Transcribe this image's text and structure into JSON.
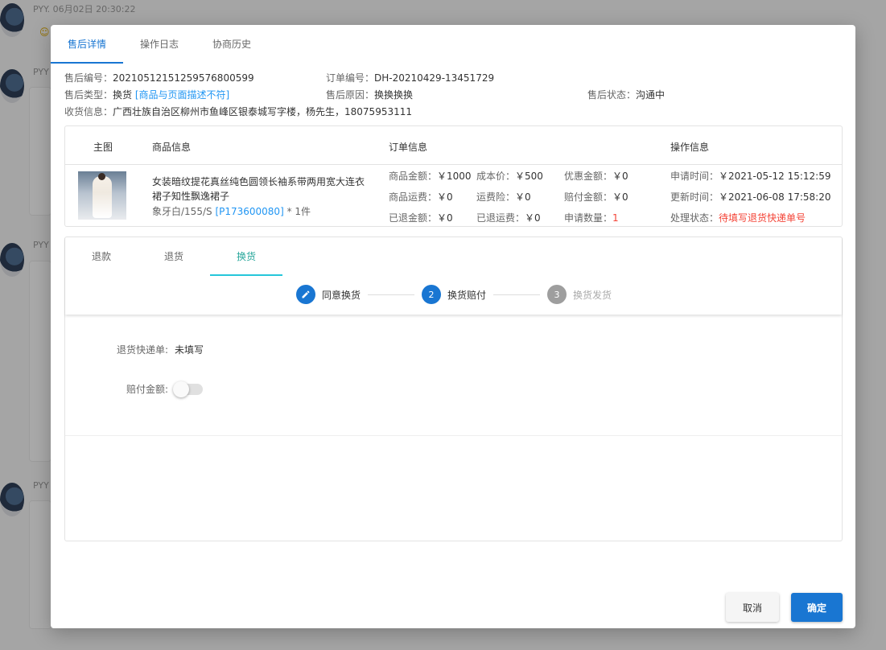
{
  "background": {
    "chat_name": "PYY",
    "chat_time": "06月02日 20:30:22",
    "names": [
      "PYY",
      "PYY",
      "PYY"
    ]
  },
  "tabs": [
    {
      "label": "售后详情",
      "active": true
    },
    {
      "label": "操作日志",
      "active": false
    },
    {
      "label": "协商历史",
      "active": false
    }
  ],
  "info": {
    "aftersale_no_label": "售后编号：",
    "aftersale_no": "20210512151259576800599",
    "order_no_label": "订单编号：",
    "order_no": "DH-20210429-13451729",
    "type_label": "售后类型：",
    "type": "换货",
    "type_reason_link": "[商品与页面描述不符]",
    "reason_label": "售后原因：",
    "reason": "换换换换",
    "status_label": "售后状态：",
    "status": "沟通中",
    "address_label": "收货信息：",
    "address": "广西壮族自治区柳州市鱼峰区银泰城写字楼，杨先生，18075953111"
  },
  "goods_table": {
    "headers": [
      "主图",
      "商品信息",
      "订单信息",
      "操作信息"
    ],
    "goods_name": "女装暗纹提花真丝纯色圆领长袖系带两用宽大连衣裙子知性飘逸裙子",
    "spec_prefix": "象牙白/155/S",
    "sku_link": "[P173600080]",
    "qty": "* 1件",
    "order": {
      "goods_amount_label": "商品金额：",
      "goods_amount": "￥1000",
      "cost_label": "成本价：",
      "cost": "￥500",
      "discount_label": "优惠金额：",
      "discount": "￥0",
      "freight_label": "商品运费：",
      "freight": "￥0",
      "freight_ins_label": "运费险：",
      "freight_ins": "￥0",
      "compensation_label": "赔付金额：",
      "compensation": "￥0",
      "refunded_label": "已退金额：",
      "refunded": "￥0",
      "refunded_freight_label": "已退运费：",
      "refunded_freight": "￥0",
      "apply_qty_label": "申请数量：",
      "apply_qty": "1"
    },
    "operation": {
      "apply_time_label": "申请时间：",
      "apply_time": "￥2021-05-12 15:12:59",
      "update_time_label": "更新时间：",
      "update_time": "￥2021-06-08 17:58:20",
      "process_status_label": "处理状态：",
      "process_status": "待填写退货快递单号"
    }
  },
  "sub_tabs": [
    {
      "label": "退款",
      "active": false
    },
    {
      "label": "退货",
      "active": false
    },
    {
      "label": "换货",
      "active": true
    }
  ],
  "steps": [
    {
      "label": "同意换货",
      "num": "",
      "state": "done"
    },
    {
      "label": "换货赔付",
      "num": "2",
      "state": "active"
    },
    {
      "label": "换货发货",
      "num": "3",
      "state": "pending"
    }
  ],
  "form": {
    "return_express_label": "退货快递单:",
    "return_express_value": "未填写",
    "compensation_label": "赔付金额:",
    "compensation_toggle_on": false
  },
  "buttons": {
    "cancel": "取消",
    "confirm": "确定"
  }
}
